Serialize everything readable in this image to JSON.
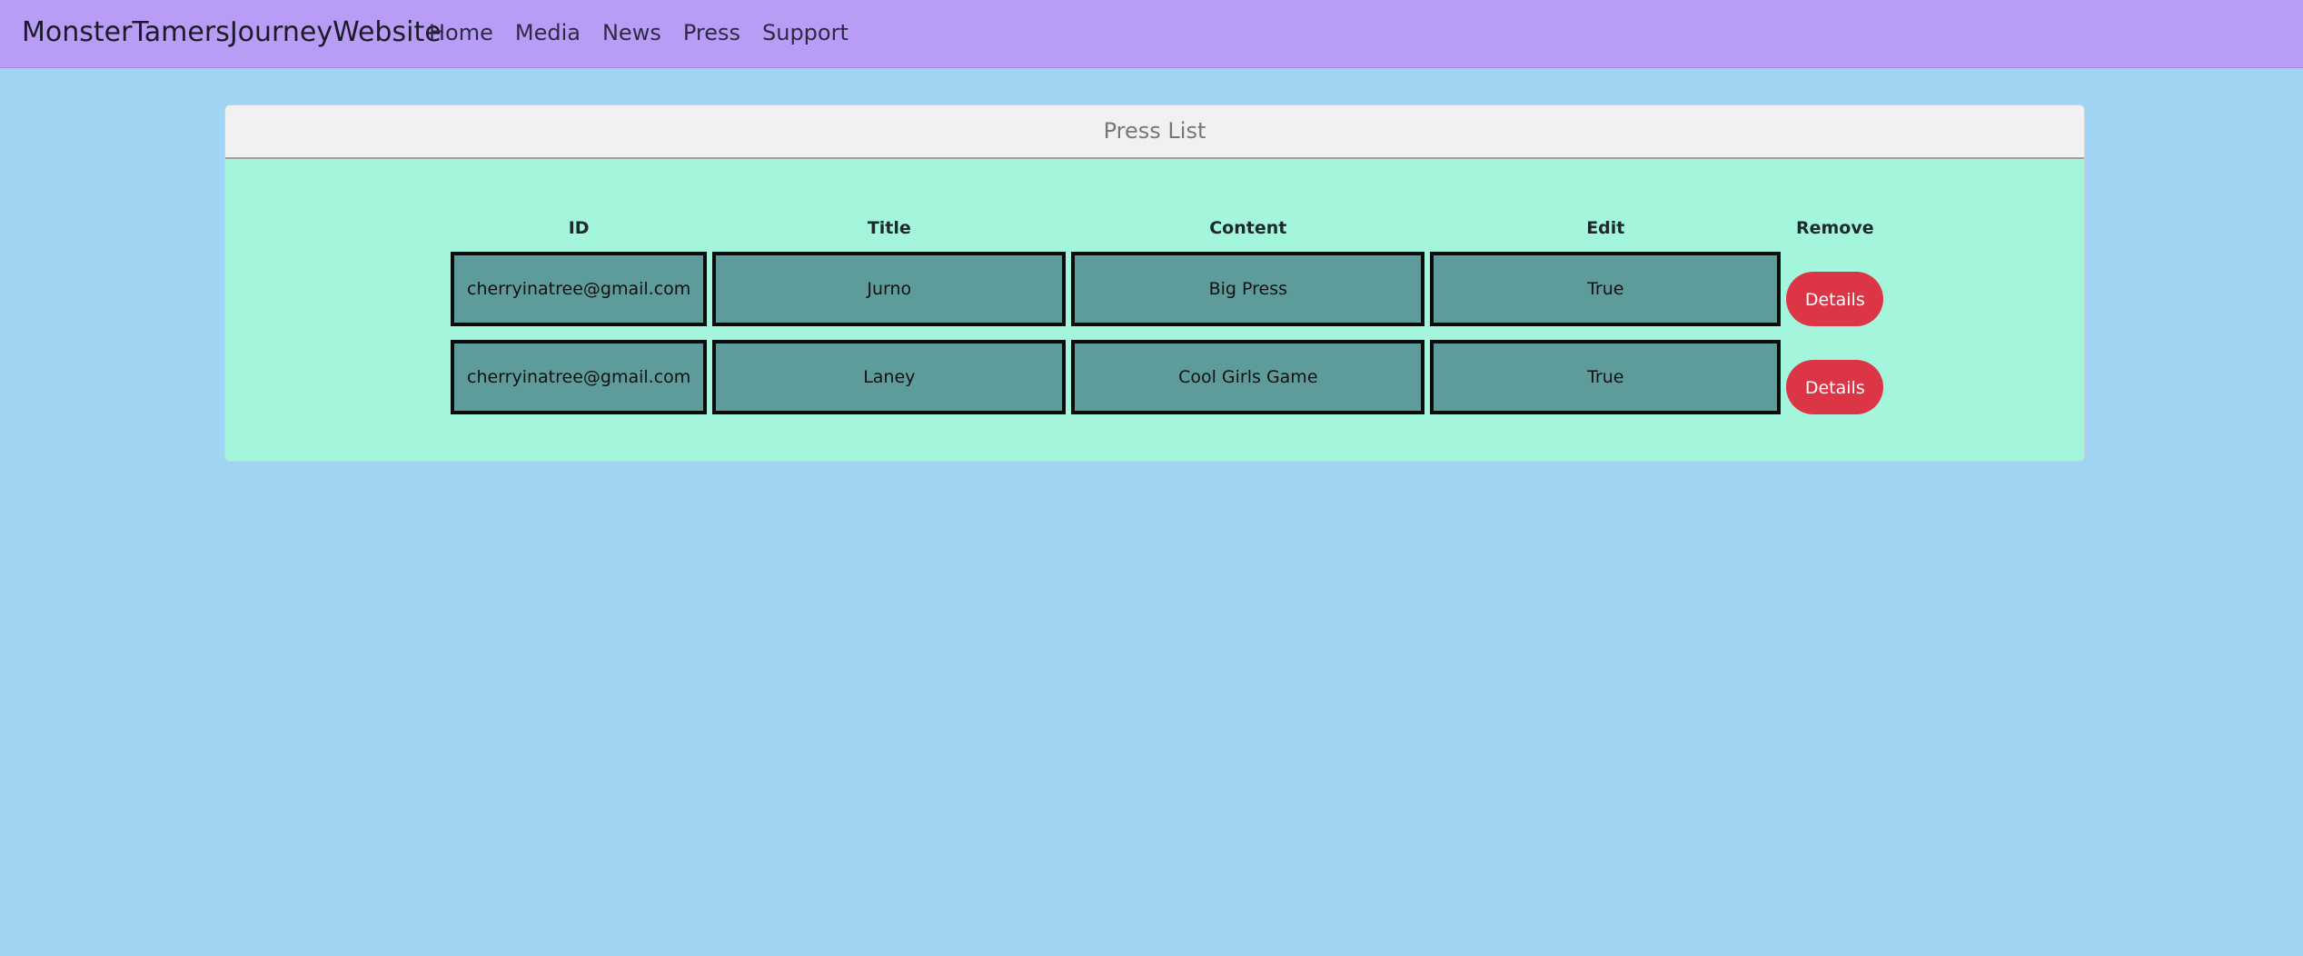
{
  "navbar": {
    "brand": "MonsterTamersJourneyWebsite",
    "links": [
      "Home",
      "Media",
      "News",
      "Press",
      "Support"
    ]
  },
  "card": {
    "header": "Press List"
  },
  "table": {
    "columns": [
      "ID",
      "Title",
      "Content",
      "Edit",
      "Remove"
    ],
    "rows": [
      {
        "id": "cherryinatree@gmail.com",
        "title": "Jurno",
        "content": "Big Press",
        "edit": "True",
        "action": "Details"
      },
      {
        "id": "cherryinatree@gmail.com",
        "title": "Laney",
        "content": "Cool Girls Game",
        "edit": "True",
        "action": "Details"
      }
    ]
  },
  "colors": {
    "navbar": "#b99cf5",
    "page_background": "#a0d4f2",
    "card_body": "#a3f5dc",
    "card_header": "#f1f1f1",
    "cell": "#5e9c9c",
    "details_button": "#dc3545"
  }
}
